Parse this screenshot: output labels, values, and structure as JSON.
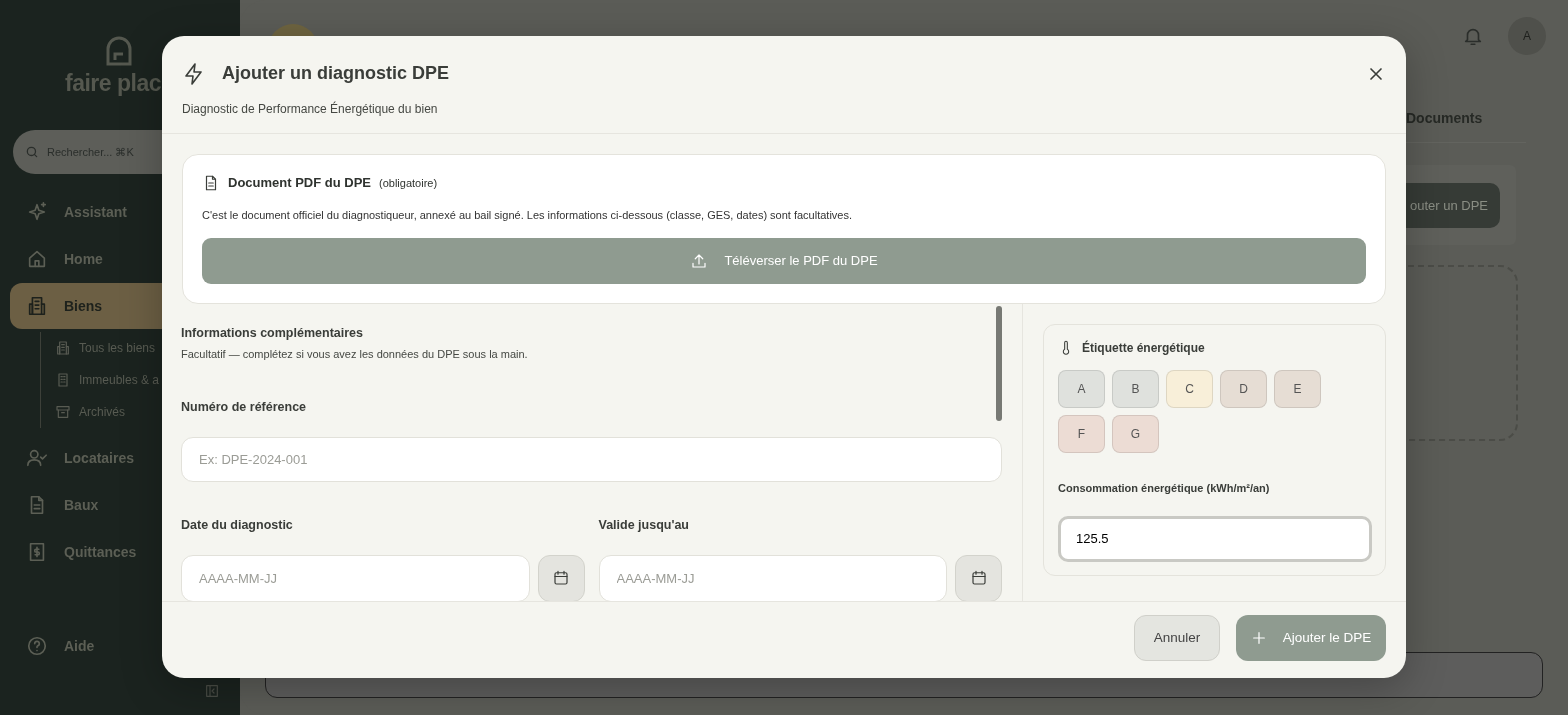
{
  "sidebar": {
    "logo_text": "faire plac",
    "search": {
      "placeholder": "Rechercher... ⌘K"
    },
    "items": [
      {
        "label": "Assistant",
        "selected": false
      },
      {
        "label": "Home",
        "selected": false
      },
      {
        "label": "Biens",
        "selected": true,
        "children": [
          {
            "label": "Tous les biens"
          },
          {
            "label": "Immeubles & a"
          },
          {
            "label": "Archivés"
          }
        ]
      },
      {
        "label": "Locataires",
        "selected": false
      },
      {
        "label": "Baux",
        "selected": false
      },
      {
        "label": "Quittances",
        "selected": false
      }
    ],
    "help": "Aide"
  },
  "main": {
    "avatar": "A",
    "tab": "Documents",
    "add_button": "outer un DPE"
  },
  "modal": {
    "title": "Ajouter un diagnostic DPE",
    "subtitle": "Diagnostic de Performance Énergétique du bien",
    "pdf_card": {
      "title": "Document PDF du DPE",
      "badge": "(obligatoire)",
      "description": "C'est le document officiel du diagnostiqueur, annexé au bail signé. Les informations ci-dessous (classe, GES, dates) sont facultatives.",
      "upload_button": "Téléverser le PDF du DPE"
    },
    "info": {
      "title": "Informations complémentaires",
      "subtitle": "Facultatif — complétez si vous avez les données du DPE sous la main.",
      "reference": {
        "label": "Numéro de référence",
        "placeholder": "Ex: DPE-2024-001"
      },
      "dates": [
        {
          "label": "Date du diagnostic",
          "placeholder": "AAAA-MM-JJ"
        },
        {
          "label": "Valide jusqu'au",
          "placeholder": "AAAA-MM-JJ"
        }
      ]
    },
    "energy": {
      "title": "Étiquette énergétique",
      "classes": [
        {
          "label": "A",
          "color": "#dfe1dd",
          "selected": false
        },
        {
          "label": "B",
          "color": "#dfe1dd",
          "selected": false
        },
        {
          "label": "C",
          "color": "#f8efd9",
          "selected": false
        },
        {
          "label": "D",
          "color": "#e6ddd4",
          "selected": false
        },
        {
          "label": "E",
          "color": "#e6ddd4",
          "selected": false
        },
        {
          "label": "F",
          "color": "#ecdcd4",
          "selected": false
        },
        {
          "label": "G",
          "color": "#ecdcd4",
          "selected": false
        }
      ],
      "consumption": {
        "label": "Consommation énergétique (kWh/m²/an)",
        "value": "125.5"
      }
    },
    "buttons": {
      "cancel": "Annuler",
      "submit": "Ajouter le DPE"
    }
  }
}
